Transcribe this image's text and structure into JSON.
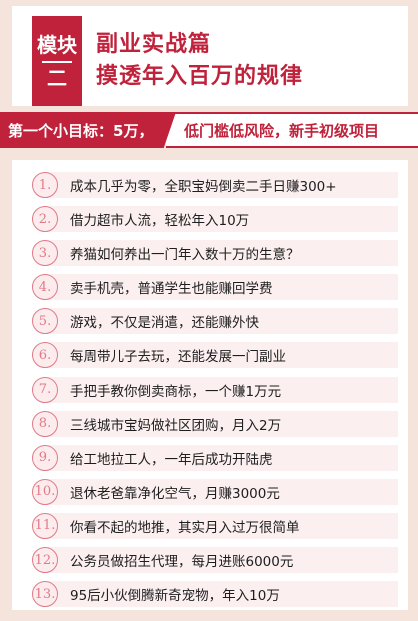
{
  "module": {
    "badge_line1": "模块",
    "badge_line2": "二",
    "title_line1": "副业实战篇",
    "title_line2": "摸透年入百万的规律"
  },
  "goal": {
    "left": "第一个小目标：5万，",
    "right": "低门槛低风险，新手初级项目"
  },
  "items": [
    {
      "num": "1.",
      "text": "成本几乎为零，全职宝妈倒卖二手日赚300+"
    },
    {
      "num": "2.",
      "text": "借力超市人流，轻松年入10万"
    },
    {
      "num": "3.",
      "text": "养猫如何养出一门年入数十万的生意？"
    },
    {
      "num": "4.",
      "text": "卖手机壳，普通学生也能赚回学费"
    },
    {
      "num": "5.",
      "text": "游戏，不仅是消遣，还能赚外快"
    },
    {
      "num": "6.",
      "text": "每周带儿子去玩，还能发展一门副业"
    },
    {
      "num": "7.",
      "text": "手把手教你倒卖商标，一个赚1万元"
    },
    {
      "num": "8.",
      "text": "三线城市宝妈做社区团购，月入2万"
    },
    {
      "num": "9.",
      "text": "给工地拉工人，一年后成功开陆虎"
    },
    {
      "num": "10.",
      "text": "退休老爸靠净化空气，月赚3000元"
    },
    {
      "num": "11.",
      "text": "你看不起的地推，其实月入过万很简单"
    },
    {
      "num": "12.",
      "text": "公务员做招生代理，每月进账6000元"
    },
    {
      "num": "13.",
      "text": "95后小伙倒腾新奇宠物，年入10万"
    }
  ],
  "colors": {
    "accent": "#c0223b",
    "background": "#f4e4dc",
    "badge_ring": "#e07a86"
  }
}
